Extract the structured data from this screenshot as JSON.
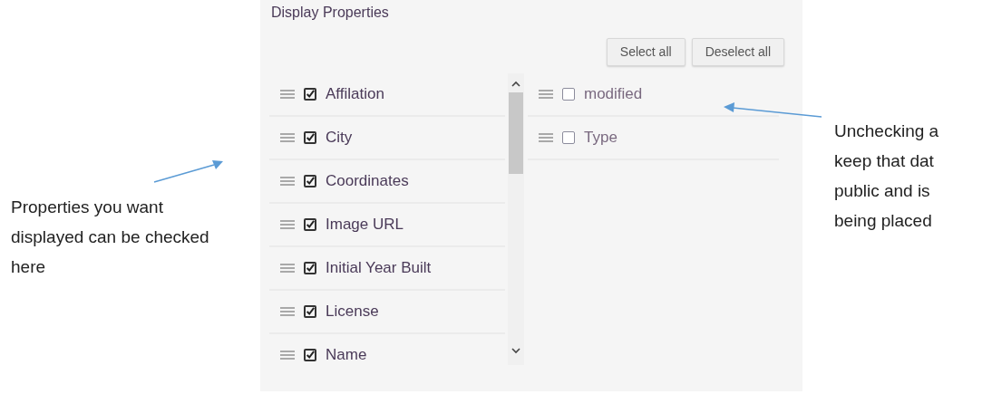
{
  "left_note": "Properties you want displayed can be checked here",
  "right_note": {
    "lines": [
      "Unchecking a",
      "keep that dat",
      "public and is",
      "being placed"
    ]
  },
  "panel": {
    "title": "Display Properties",
    "buttons": [
      "Select all",
      "Deselect all"
    ],
    "displayed": [
      {
        "label": "Affilation",
        "checked": true
      },
      {
        "label": "City",
        "checked": true
      },
      {
        "label": "Coordinates",
        "checked": true
      },
      {
        "label": "Image URL",
        "checked": true
      },
      {
        "label": "Initial Year Built",
        "checked": true
      },
      {
        "label": "License",
        "checked": true
      },
      {
        "label": "Name",
        "checked": true
      }
    ],
    "hidden": [
      {
        "label": "modified",
        "checked": false
      },
      {
        "label": "Type",
        "checked": false
      }
    ]
  }
}
